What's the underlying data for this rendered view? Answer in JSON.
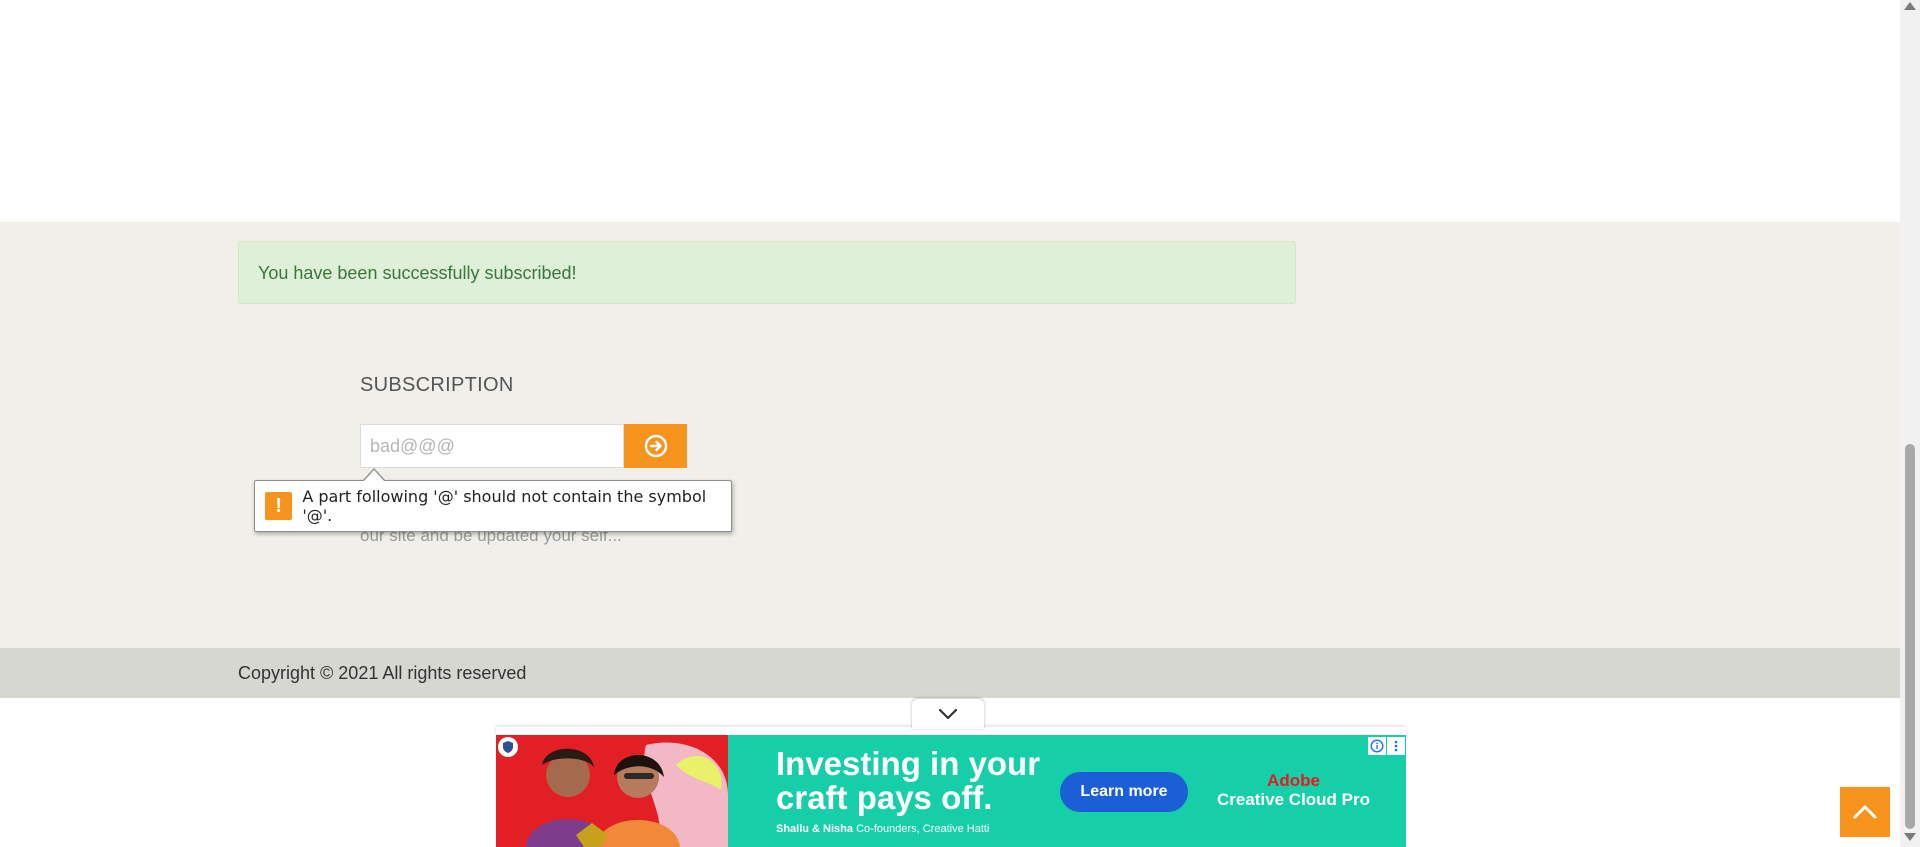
{
  "alert": {
    "message": "You have been successfully subscribed!"
  },
  "subscription": {
    "title": "SUBSCRIPTION",
    "email_value": "bad@@@",
    "submit_icon": "arrow-right-circle-icon",
    "description_fragment": "our site and be updated your self..."
  },
  "validation_tooltip": {
    "icon": "warning-icon",
    "message": "A part following '@' should not contain the symbol '@'."
  },
  "footer": {
    "copyright": "Copyright © 2021 All rights reserved"
  },
  "back_to_top": {
    "icon": "chevron-up-icon"
  },
  "ad": {
    "collapse_icon": "chevron-down-icon",
    "headline_line1": "Investing in your",
    "headline_line2": "craft pays off.",
    "subline_names": "Shallu & Nisha",
    "subline_role": "Co-founders, Creative Hatti",
    "cta_label": "Learn more",
    "brand_name": "Adobe",
    "brand_product": "Creative Cloud Pro",
    "info_icon": "info-icon",
    "more_icon": "more-vertical-icon"
  },
  "colors": {
    "accent": "#f7941d",
    "section_bg": "#f0efe9",
    "footer_bg": "#d7d7d1",
    "alert_bg": "#dff0d8",
    "alert_text": "#3c763d",
    "ad_bg": "#16cfa8",
    "ad_cta": "#1b5fd6"
  }
}
